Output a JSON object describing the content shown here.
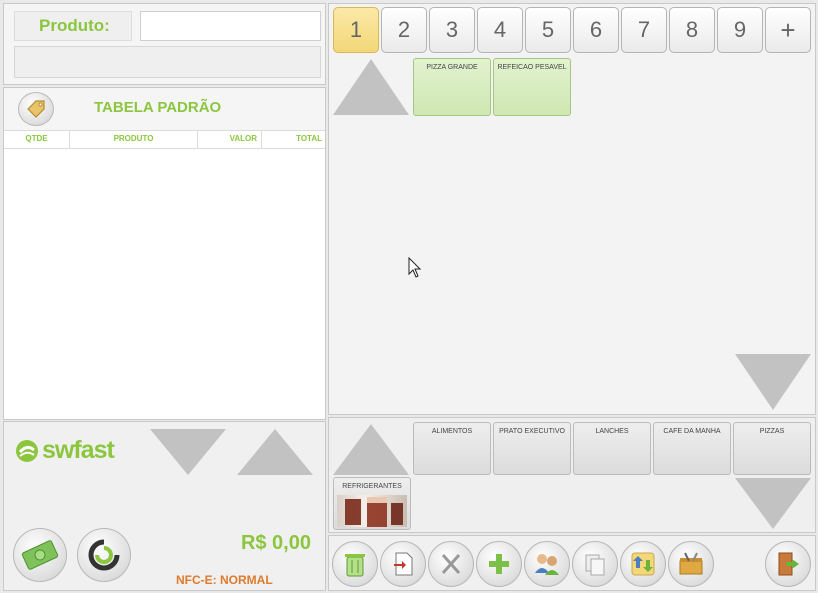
{
  "product": {
    "label": "Produto:",
    "value": "",
    "description": ""
  },
  "table": {
    "title": "TABELA PADRÃO",
    "columns": [
      "QTDE",
      "PRODUTO",
      "VALOR",
      "TOTAL"
    ]
  },
  "brand": {
    "logo_text": "swfast"
  },
  "summary": {
    "total": "R$ 0,00",
    "nfce_status": "NFC-E: NORMAL"
  },
  "pages": {
    "items": [
      "1",
      "2",
      "3",
      "4",
      "5",
      "6",
      "7",
      "8",
      "9",
      "+"
    ],
    "active": "1"
  },
  "products": [
    {
      "label": "PIZZA GRANDE"
    },
    {
      "label": "REFEICAO PESAVEL"
    }
  ],
  "categories": [
    {
      "label": "ALIMENTOS"
    },
    {
      "label": "PRATO EXECUTIVO"
    },
    {
      "label": "LANCHES"
    },
    {
      "label": "CAFE DA MANHA"
    },
    {
      "label": "PIZZAS"
    },
    {
      "label": "REFRIGERANTES"
    }
  ],
  "toolbar": {
    "icons": [
      "trash-icon",
      "document-arrow-icon",
      "utensils-icon",
      "plus-icon",
      "users-icon",
      "copy-icon",
      "transfer-icon",
      "toolbox-icon",
      "exit-door-icon"
    ]
  },
  "colors": {
    "accent_green": "#8cc63f",
    "status_orange": "#e07b2b",
    "active_page": "#f3d778"
  }
}
